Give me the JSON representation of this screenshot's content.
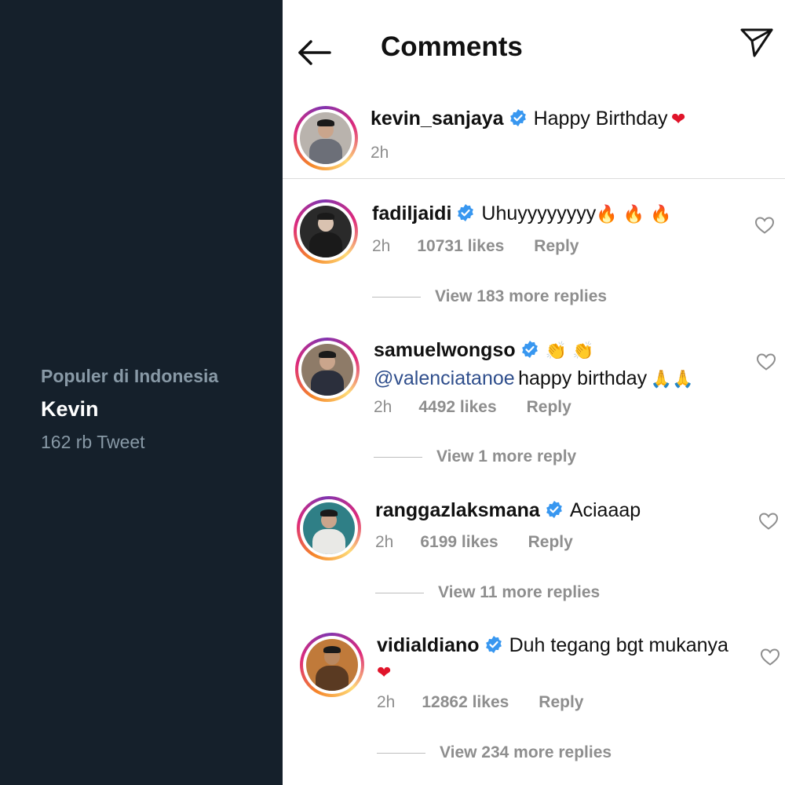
{
  "trend": {
    "context": "Populer di Indonesia",
    "name": "Kevin",
    "count": "162 rb Tweet"
  },
  "header": {
    "title": "Comments",
    "back_icon": "arrow-left-icon",
    "send_icon": "paper-plane-icon"
  },
  "caption": {
    "username": "kevin_sanjaya",
    "text": "Happy Birthday",
    "emoji": "❤",
    "time": "2h"
  },
  "comments": [
    {
      "username": "fadiljaidi",
      "text": "Uhuyyyyyyyy",
      "emoji": "🔥 🔥 🔥",
      "time": "2h",
      "likes": "10731 likes",
      "reply": "Reply",
      "view_replies": "View 183 more replies"
    },
    {
      "username": "samuelwongso",
      "emoji_inline": "👏 👏",
      "mention": "@valenciatanoe",
      "text": "happy birthday",
      "emoji": "🙏🙏",
      "time": "2h",
      "likes": "4492 likes",
      "reply": "Reply",
      "view_replies": "View 1 more reply"
    },
    {
      "username": "ranggazlaksmana",
      "text": "Aciaaap",
      "time": "2h",
      "likes": "6199 likes",
      "reply": "Reply",
      "view_replies": "View 11 more replies"
    },
    {
      "username": "vidialdiano",
      "text": "Duh tegang bgt mukanya",
      "emoji": "❤",
      "time": "2h",
      "likes": "12862 likes",
      "reply": "Reply",
      "view_replies": "View 234 more replies"
    }
  ],
  "colors": {
    "twitter_bg": "#15202b",
    "verified_blue": "#3897f0",
    "meta_gray": "#8e8e8e"
  }
}
